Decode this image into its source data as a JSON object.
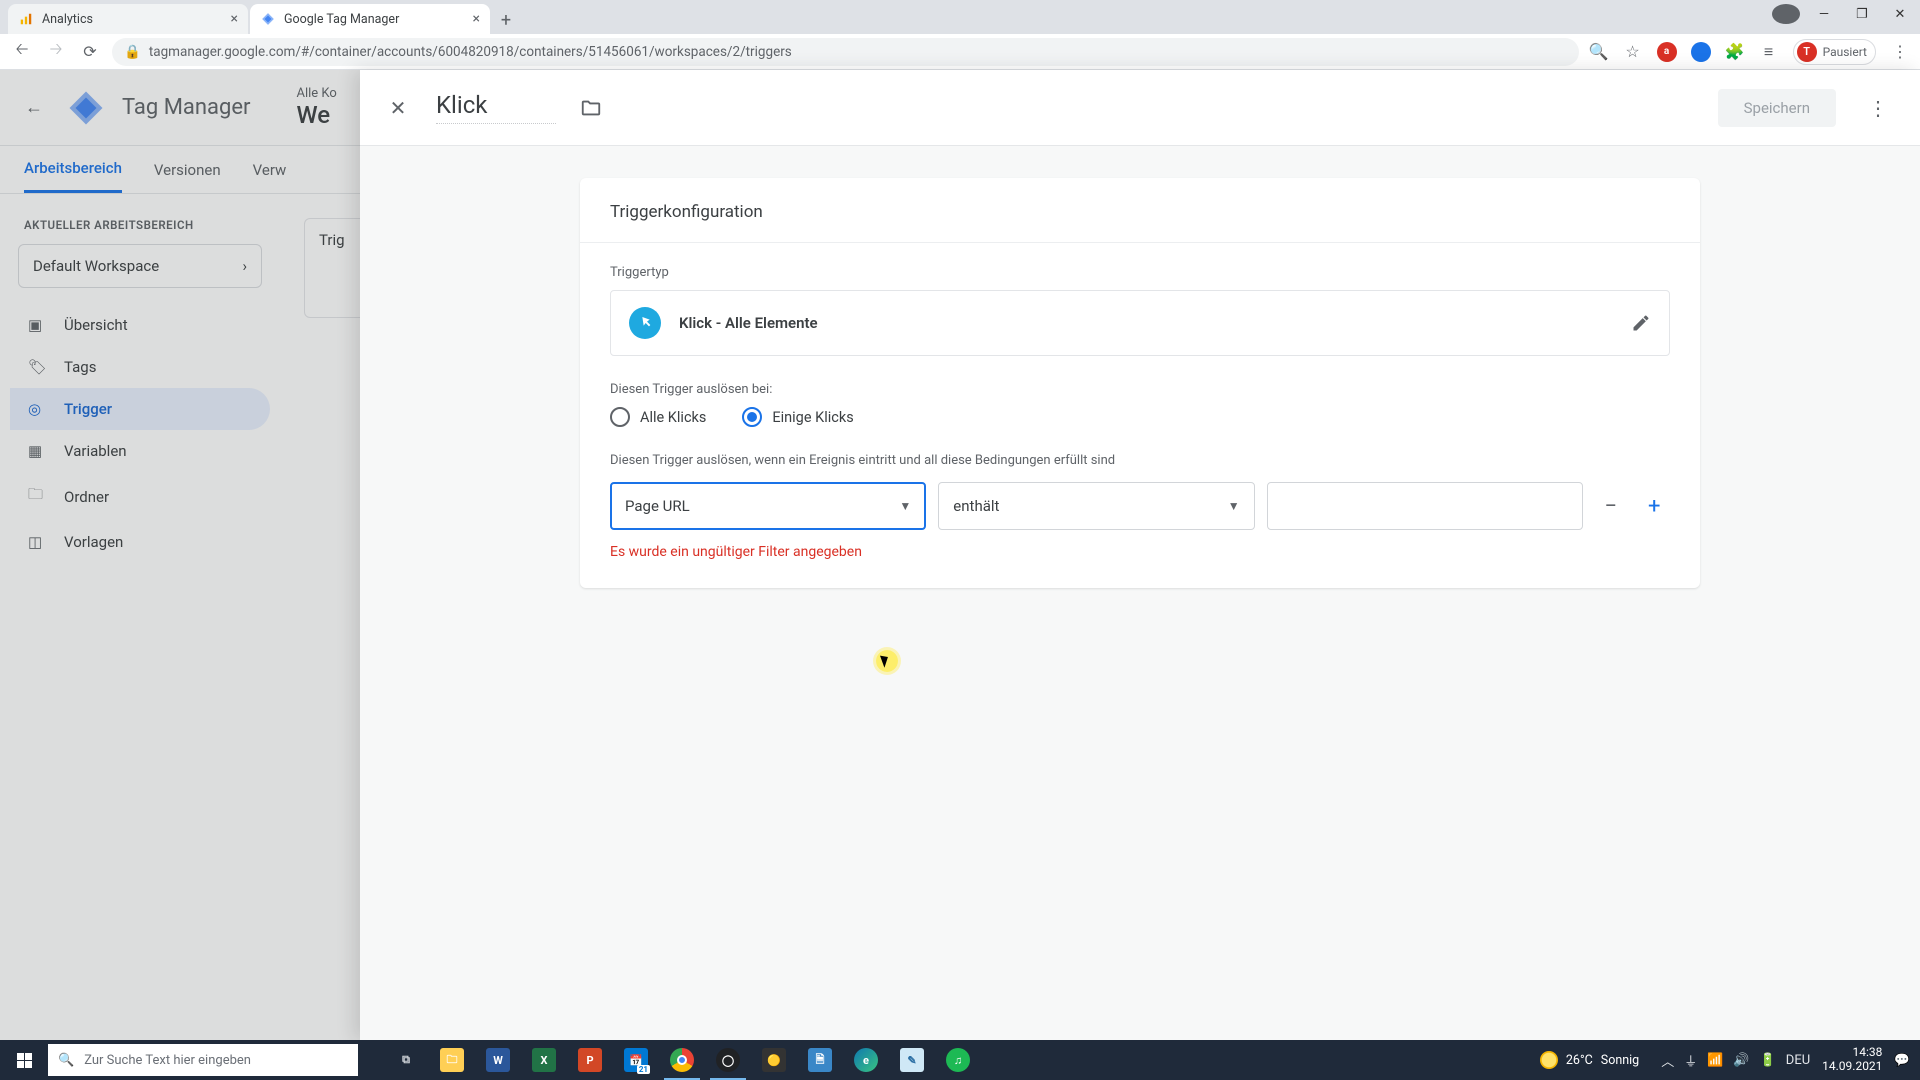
{
  "browser": {
    "tabs": [
      {
        "label": "Analytics"
      },
      {
        "label": "Google Tag Manager"
      }
    ],
    "url": "tagmanager.google.com/#/container/accounts/6004820918/containers/51456061/workspaces/2/triggers",
    "profile_initial": "T",
    "profile_status": "Pausiert",
    "ext_badge": "a"
  },
  "gtm": {
    "app_title": "Tag Manager",
    "breadcrumb_top": "Alle Ko",
    "breadcrumb_main": "We",
    "tabs": {
      "workspace": "Arbeitsbereich",
      "versions": "Versionen",
      "admin": "Verw"
    },
    "workspace_label": "AKTUELLER ARBEITSBEREICH",
    "workspace_name": "Default Workspace",
    "sidebar": {
      "overview": "Übersicht",
      "tags": "Tags",
      "triggers": "Trigger",
      "variables": "Variablen",
      "folders": "Ordner",
      "templates": "Vorlagen"
    },
    "panel_placeholder": "Trig"
  },
  "editor": {
    "title": "Klick",
    "save": "Speichern",
    "card_title": "Triggerkonfiguration",
    "type_label": "Triggertyp",
    "type_name": "Klick - Alle Elemente",
    "fire_label": "Diesen Trigger auslösen bei:",
    "radio": {
      "all": "Alle Klicks",
      "some": "Einige Klicks"
    },
    "condition_label": "Diesen Trigger auslösen, wenn ein Ereignis eintritt und all diese Bedingungen erfüllt sind",
    "select_var": "Page URL",
    "select_op": "enthält",
    "error": "Es wurde ein ungültiger Filter angegeben"
  },
  "taskbar": {
    "search_placeholder": "Zur Suche Text hier eingeben",
    "weather_temp": "26°C",
    "weather_desc": "Sonnig",
    "lang": "DEU",
    "time": "14:38",
    "date": "14.09.2021",
    "calendar_badge": "21"
  }
}
